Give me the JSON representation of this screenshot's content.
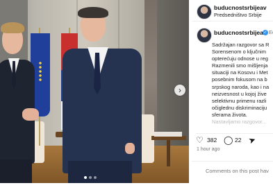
{
  "post": {
    "author": "buducnostsrbijeav",
    "location": "Predsedništvo Srbije",
    "edited_label": "Ed",
    "caption_lines": [
      "Sadržajan razgovor sa R",
      "Sorensenom o ključnim",
      "opterećuju odnose u reg",
      "Razmenili smo mišljenja",
      "situaciji na Kosovu i Met",
      "posebnim fokusom na b",
      "srpskog naroda, kao i na",
      "neizvesnost u kojoj žive",
      "selektivnu primenu razli",
      "očiglednu diskriminaciju",
      "sferama života."
    ],
    "caption_more": "Nastavljamo razgovor...",
    "likes": "382",
    "comments": "22",
    "timestamp": "1 hour ago",
    "comment_placeholder": "Comments on this post hav"
  },
  "colors": {
    "verified": "#3897f0",
    "flag_eu": "#203f9a",
    "flag_rs_red": "#c8302e",
    "flag_rs_blue": "#1f3f8e"
  },
  "icons": {
    "next": "chevron-right-icon",
    "like": "heart-icon",
    "comment": "comment-icon",
    "share": "send-icon",
    "verified": "verified-badge-icon"
  }
}
